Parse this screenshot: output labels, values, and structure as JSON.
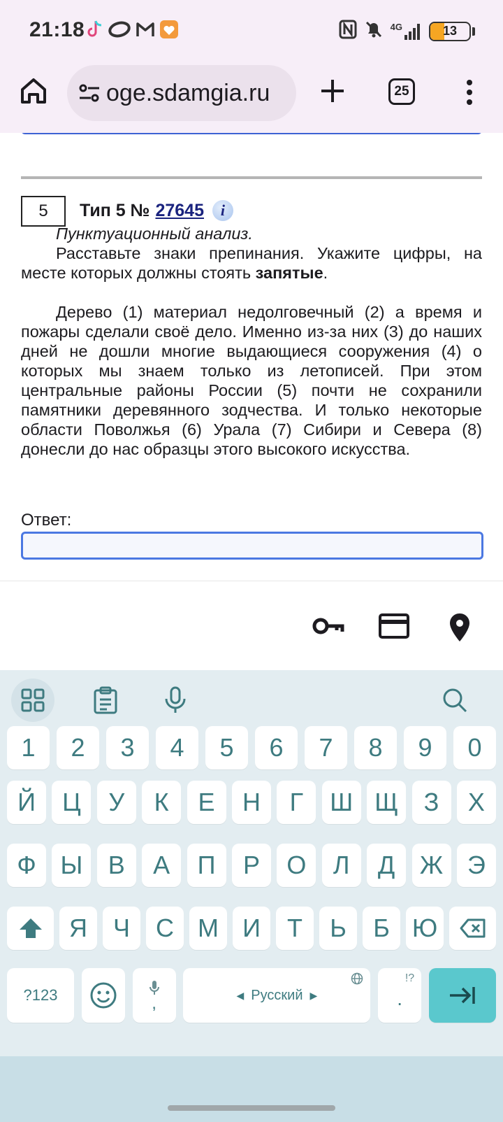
{
  "status_bar": {
    "time": "21:18",
    "network": "4G",
    "battery": "13",
    "app_icons": [
      "tiktok-icon",
      "oval-icon",
      "gmail-icon",
      "heart-app-icon"
    ],
    "status_icons": [
      "nfc-icon",
      "mute-icon",
      "signal-icon"
    ]
  },
  "browser": {
    "url": "oge.sdamgia.ru",
    "tab_count": "25"
  },
  "task": {
    "number": "5",
    "type_label": "Тип 5 №",
    "task_id": "27645",
    "info": "i",
    "subtitle": "Пунктуационный анализ.",
    "instruction_pre": "Расставьте знаки препинания. Укажите цифры, на месте которых должны стоять ",
    "instruction_bold": "запятые",
    "instruction_post": ".",
    "body": "Дерево (1) материал недолговечный (2) а время и пожары сделали своё дело. Именно из-за них (3) до наших дней не дошли многие выдающиеся сооружения (4) о которых мы знаем только из летописей. При этом центральные районы России (5) почти не сохранили памятники деревянного зодчества. И только некоторые области Поволжья (6) Урала (7) Сибири и Севера (8) донесли до нас образцы этого высокого искусства.",
    "answer_label": "Ответ:",
    "answer_value": ""
  },
  "keyboard": {
    "numbers": [
      "1",
      "2",
      "3",
      "4",
      "5",
      "6",
      "7",
      "8",
      "9",
      "0"
    ],
    "row1": [
      "Й",
      "Ц",
      "У",
      "К",
      "Е",
      "Н",
      "Г",
      "Ш",
      "Щ",
      "З",
      "Х"
    ],
    "row2": [
      "Ф",
      "Ы",
      "В",
      "А",
      "П",
      "Р",
      "О",
      "Л",
      "Д",
      "Ж",
      "Э"
    ],
    "row3": [
      "Я",
      "Ч",
      "С",
      "М",
      "И",
      "Т",
      "Ь",
      "Б",
      "Ю"
    ],
    "symbols_key": "?123",
    "comma": ",",
    "space_label": "Русский",
    "period": ".",
    "period_sup": "!?"
  },
  "colors": {
    "status_bg": "#f7eef8",
    "keyboard_bg": "#e3edf1",
    "key_text": "#3e7b80",
    "enter_key": "#5ac8cd",
    "link": "#1a237e",
    "input_border": "#4b78e2"
  }
}
